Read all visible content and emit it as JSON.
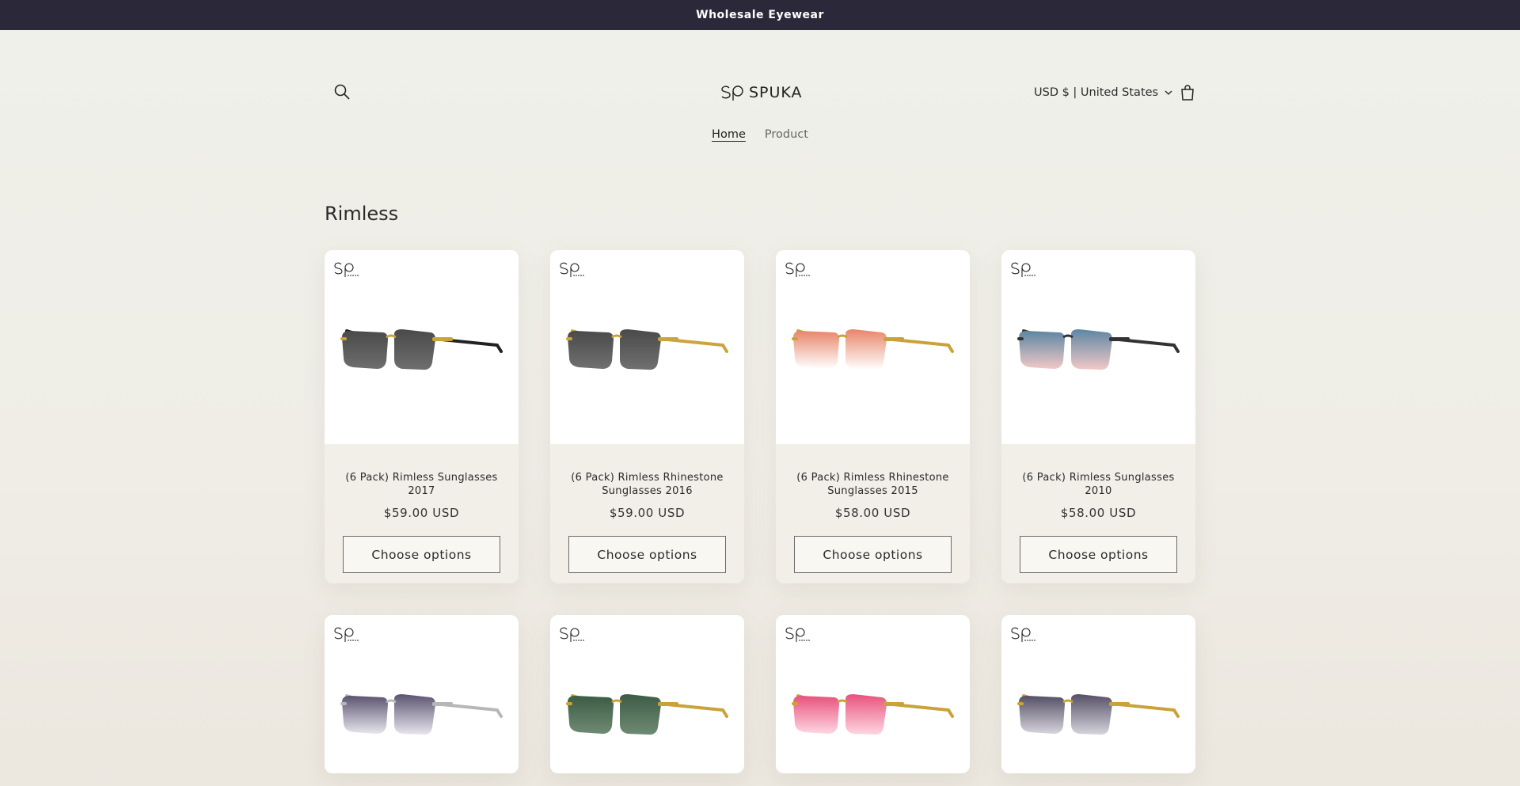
{
  "announcement": "Wholesale Eyewear",
  "header": {
    "logo_text": "SPUKA",
    "currency_label": "USD $ | United States"
  },
  "nav": {
    "items": [
      {
        "label": "Home",
        "active": true
      },
      {
        "label": "Product",
        "active": false
      }
    ]
  },
  "collection": {
    "title": "Rimless",
    "button_label": "Choose options",
    "products": [
      {
        "title": "(6 Pack) Rimless Sunglasses 2017",
        "price": "$59.00 USD",
        "lens_top": "#4a4a4a",
        "lens_bottom": "#6e6e6e",
        "frame": "#c9a23a",
        "temple": "#222222"
      },
      {
        "title": "(6 Pack) Rimless Rhinestone Sunglasses 2016",
        "price": "$59.00 USD",
        "lens_top": "#4a4a4a",
        "lens_bottom": "#707070",
        "frame": "#caa43c",
        "temple": "#caa43c"
      },
      {
        "title": "(6 Pack) Rimless Rhinestone Sunglasses 2015",
        "price": "$58.00 USD",
        "lens_top": "#e8866a",
        "lens_bottom": "#ffffff",
        "frame": "#c9a23a",
        "temple": "#c9a23a"
      },
      {
        "title": "(6 Pack) Rimless Sunglasses 2010",
        "price": "$58.00 USD",
        "lens_top": "#5d86a3",
        "lens_bottom": "#f1c9c7",
        "frame": "#333333",
        "temple": "#333333"
      },
      {
        "title": "",
        "price": "",
        "lens_top": "#5b5470",
        "lens_bottom": "#e8e6ee",
        "frame": "#b7b7b7",
        "temple": "#b7b7b7"
      },
      {
        "title": "",
        "price": "",
        "lens_top": "#3d5c45",
        "lens_bottom": "#6f8a73",
        "frame": "#c9a23a",
        "temple": "#c9a23a"
      },
      {
        "title": "",
        "price": "",
        "lens_top": "#e8527d",
        "lens_bottom": "#ffd6e2",
        "frame": "#c9a23a",
        "temple": "#c9a23a"
      },
      {
        "title": "",
        "price": "",
        "lens_top": "#555066",
        "lens_bottom": "#d6d4dc",
        "frame": "#c9a23a",
        "temple": "#c9a23a"
      }
    ]
  }
}
